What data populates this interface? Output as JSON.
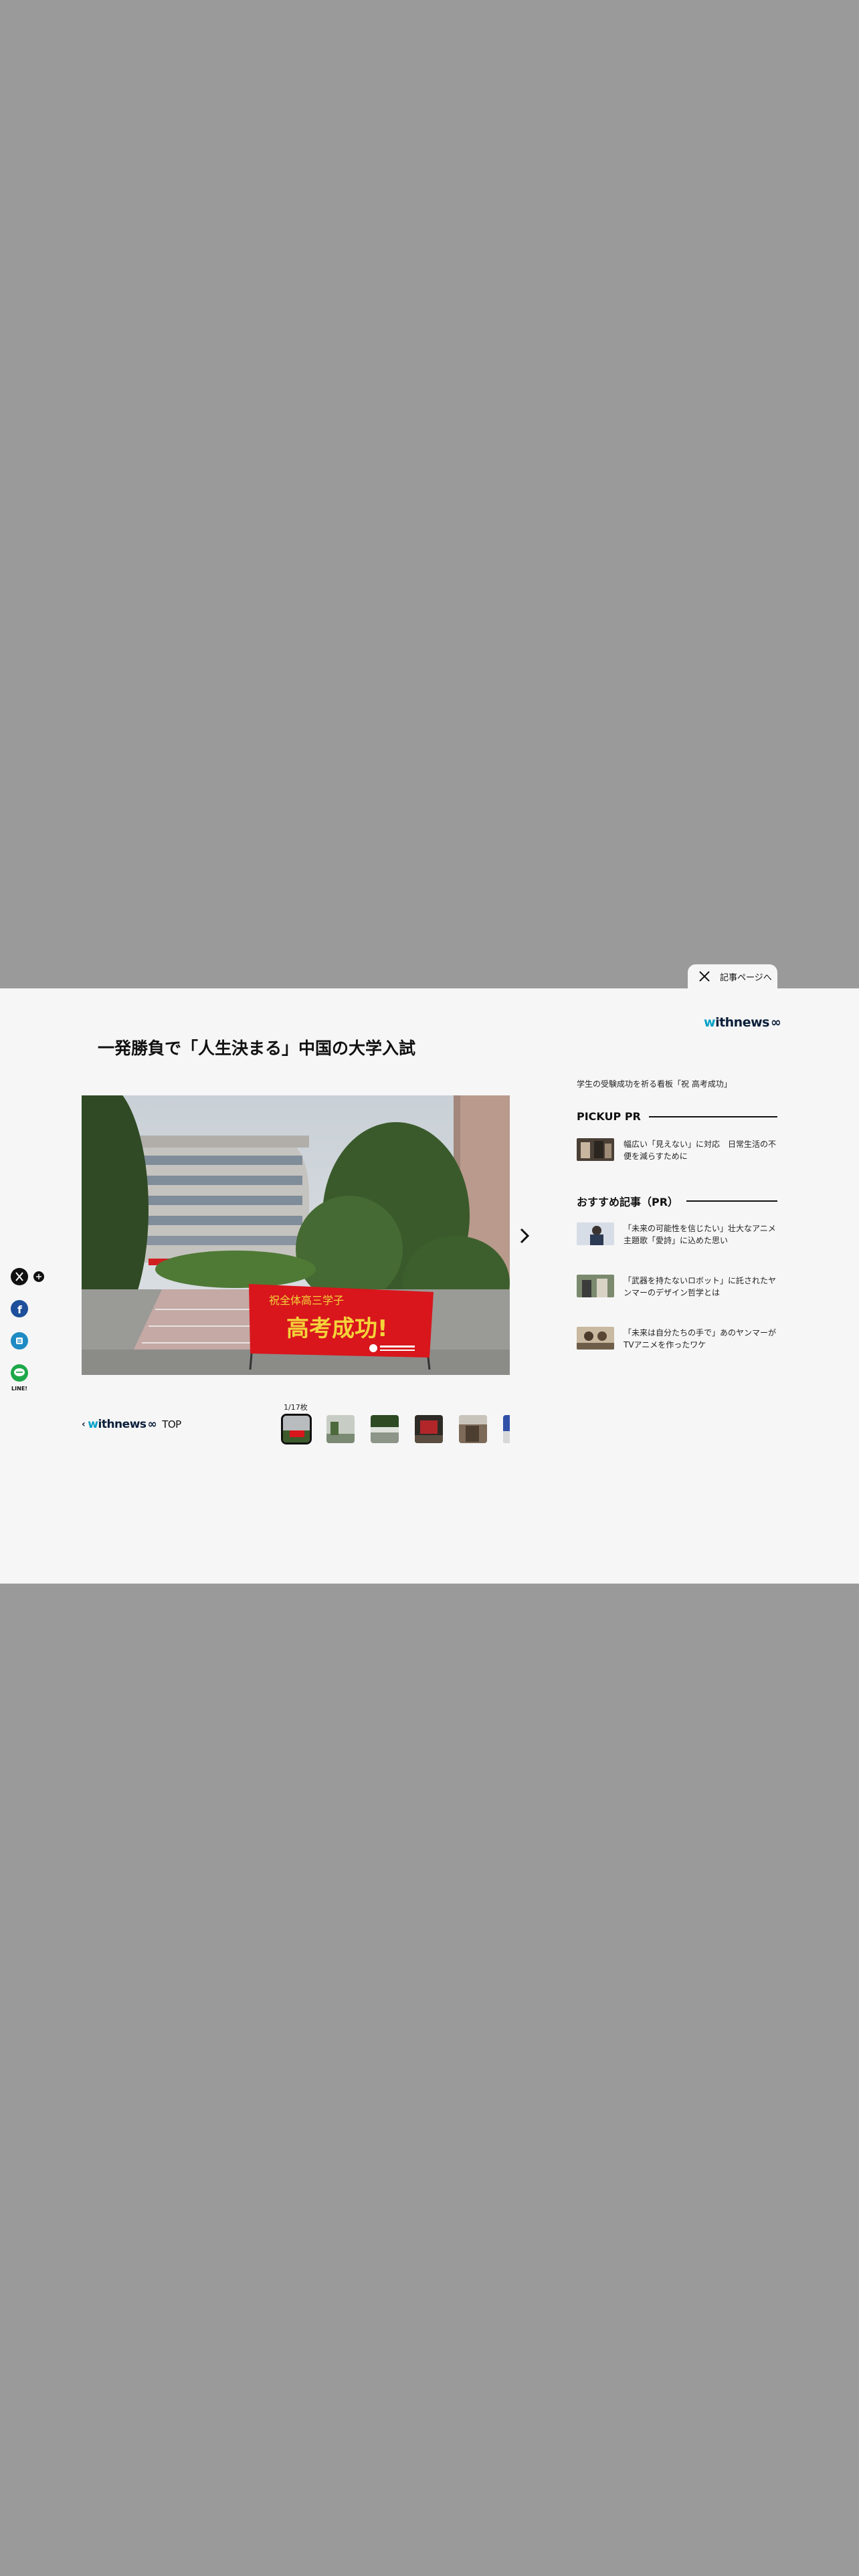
{
  "close_tab": {
    "label": "記事ページへ"
  },
  "brand": {
    "prefix": "w",
    "main": "ithnews",
    "suffix": "∞"
  },
  "article": {
    "title": "一発勝負で「人生決まる」中国の大学入試"
  },
  "photo": {
    "banner_small": "祝全体高三学子",
    "banner_large": "高考成功!",
    "caption": "学生の受験成功を祈る看板「祝 高考成功」"
  },
  "gallery": {
    "counter": "1/17枚",
    "top_label": "TOP"
  },
  "pickup": {
    "title": "PICKUP PR",
    "items": [
      {
        "text": "幅広い「見えない」に対応　日常生活の不便を減らすために"
      }
    ]
  },
  "recommended": {
    "title": "おすすめ記事（PR）",
    "items": [
      {
        "text": "「未来の可能性を信じたい」壮大なアニメ主題歌「愛詩」に込めた思い"
      },
      {
        "text": "「武器を持たないロボット」に託されたヤンマーのデザイン哲学とは"
      },
      {
        "text": "「未来は自分たちの手で」あのヤンマーがTVアニメを作ったワケ"
      }
    ]
  },
  "social": {
    "line_label": "LINE!"
  },
  "colors": {
    "overlay": "#9a9a9a",
    "sheet": "#f6f6f6",
    "banner": "#d8161c",
    "banner_text": "#f3d43a",
    "brand_w": "#00a0c8"
  }
}
